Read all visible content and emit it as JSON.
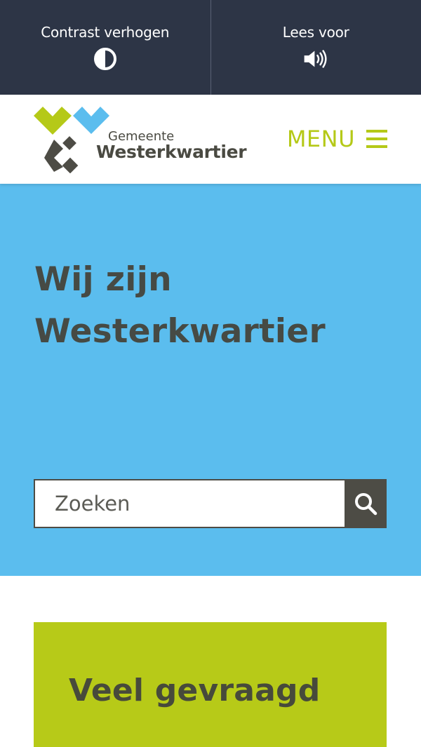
{
  "accessibility_bar": {
    "contrast_label": "Contrast verhogen",
    "read_aloud_label": "Lees voor"
  },
  "header": {
    "logo_small": "Gemeente",
    "logo_big": "Westerkwartier",
    "menu_label": "MENU"
  },
  "hero": {
    "title": "Wij zijn Westerkwartier",
    "search_placeholder": "Zoeken"
  },
  "faq": {
    "title": "Veel gevraagd"
  },
  "colors": {
    "top_bar": "#2d3546",
    "accent_green": "#b5c918",
    "hero_blue": "#5bbdee",
    "dark_text": "#464a44"
  },
  "icons": {
    "contrast": "contrast-icon",
    "read_aloud": "speaker-icon",
    "menu": "hamburger-icon",
    "search": "search-icon"
  }
}
